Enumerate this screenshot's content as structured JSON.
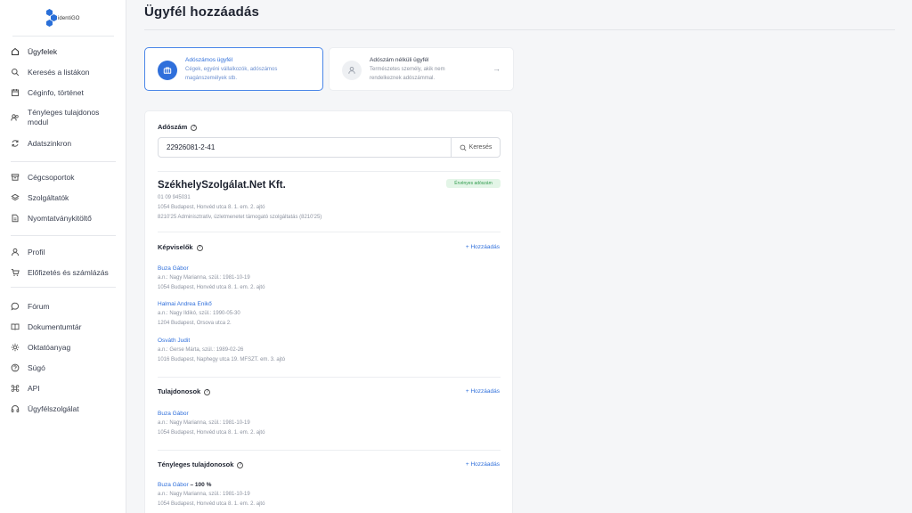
{
  "logo": {
    "text": "identiGO"
  },
  "nav": {
    "items": [
      {
        "label": "Ügyfelek",
        "icon": "home-icon"
      },
      {
        "label": "Keresés a listákon",
        "icon": "search-icon"
      },
      {
        "label": "Céginfo, történet",
        "icon": "calendar-icon"
      },
      {
        "label": "Tényleges tulajdonos modul",
        "icon": "users-icon"
      },
      {
        "label": "Adatszinkron",
        "icon": "sync-icon"
      },
      {
        "label": "Cégcsoportok",
        "icon": "archive-icon"
      },
      {
        "label": "Szolgáltatók",
        "icon": "layers-icon"
      },
      {
        "label": "Nyomtatványkitöltő",
        "icon": "file-icon"
      },
      {
        "label": "Profil",
        "icon": "user-icon"
      },
      {
        "label": "Előfizetés és számlázás",
        "icon": "cart-icon"
      },
      {
        "label": "Fórum",
        "icon": "chat-icon"
      },
      {
        "label": "Dokumentumtár",
        "icon": "book-icon"
      },
      {
        "label": "Oktatóanyag",
        "icon": "sun-icon"
      },
      {
        "label": "Súgó",
        "icon": "help-icon"
      },
      {
        "label": "API",
        "icon": "command-icon"
      },
      {
        "label": "Ügyfélszolgálat",
        "icon": "headphones-icon"
      }
    ]
  },
  "page": {
    "title": "Ügyfél hozzáadás"
  },
  "type_cards": [
    {
      "title": "Adószámos ügyfél",
      "desc": "Cégek, egyéni vállalkozók, adószámos magánszemélyek stb."
    },
    {
      "title": "Adószám nélküli ügyfél",
      "desc": "Természetes személy, akik nem rendelkeznek adószámmal.",
      "arrow": "→"
    }
  ],
  "form": {
    "tax_label": "Adószám",
    "tax_value": "22926081-2-41",
    "search_label": "Keresés",
    "company_name": "SzékhelySzolgálat.Net Kft.",
    "status_badge": "Érvényes adószám",
    "reg_number": "01 09 945031",
    "address": "1054 Budapest, Honvéd utca 8. 1. em. 2. ajtó",
    "activity": "8210'25 Adminisztratív, üzletmenetet támogató szolgáltatás (8210'25)"
  },
  "representatives": {
    "title": "Képviselők",
    "add_label": "+ Hozzáadás",
    "people": [
      {
        "name": "Buza Gábor",
        "mother": "a.n.: Nagy Marianna, szül.: 1981-10-19",
        "address": "1054 Budapest, Honvéd utca 8. 1. em. 2. ajtó"
      },
      {
        "name": "Halmai Andrea Enikő",
        "mother": "a.n.: Nagy Ildikó, szül.: 1990-05-30",
        "address": "1204 Budapest, Orsova utca 2."
      },
      {
        "name": "Osváth Judit",
        "mother": "a.n.: Gerse Márta, szül.: 1989-02-26",
        "address": "1016 Budapest, Naphegy utca 19. MFSZT. em. 3. ajtó"
      }
    ]
  },
  "owners": {
    "title": "Tulajdonosok",
    "add_label": "+ Hozzáadás",
    "people": [
      {
        "name": "Buza Gábor",
        "mother": "a.n.: Nagy Marianna, szül.: 1981-10-19",
        "address": "1054 Budapest, Honvéd utca 8. 1. em. 2. ajtó"
      }
    ]
  },
  "beneficial": {
    "title": "Tényleges tulajdonosok",
    "add_label": "+ Hozzáadás",
    "people": [
      {
        "name": "Buza Gábor",
        "share": " – 100 %",
        "mother": "a.n.: Nagy Marianna, szül.: 1981-10-19",
        "address": "1054 Budapest, Honvéd utca 8. 1. em. 2. ajtó"
      }
    ]
  }
}
